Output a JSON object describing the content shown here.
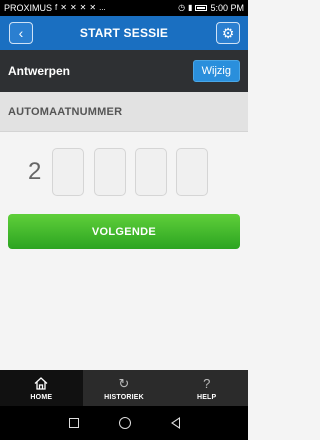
{
  "status_bar": {
    "carrier": "PROXIMUS",
    "time": "5:00 PM",
    "extra": "..."
  },
  "header": {
    "title": "START SESSIE",
    "back_icon": "back-arrow-icon",
    "settings_icon": "gear-icon"
  },
  "location": {
    "name": "Antwerpen",
    "change_label": "Wijzig"
  },
  "section": {
    "title": "AUTOMAATNUMMER"
  },
  "digits": {
    "prefix": "2",
    "slots": [
      "",
      "",
      "",
      ""
    ]
  },
  "actions": {
    "next_label": "VOLGENDE"
  },
  "tabs": [
    {
      "label": "HOME",
      "icon": "home-icon",
      "active": true
    },
    {
      "label": "HISTORIEK",
      "icon": "history-icon",
      "active": false
    },
    {
      "label": "HELP",
      "icon": "help-icon",
      "active": false
    }
  ],
  "colors": {
    "header_blue": "#1a6fc1",
    "button_green": "#2ca421",
    "location_bar": "#2e3033"
  }
}
